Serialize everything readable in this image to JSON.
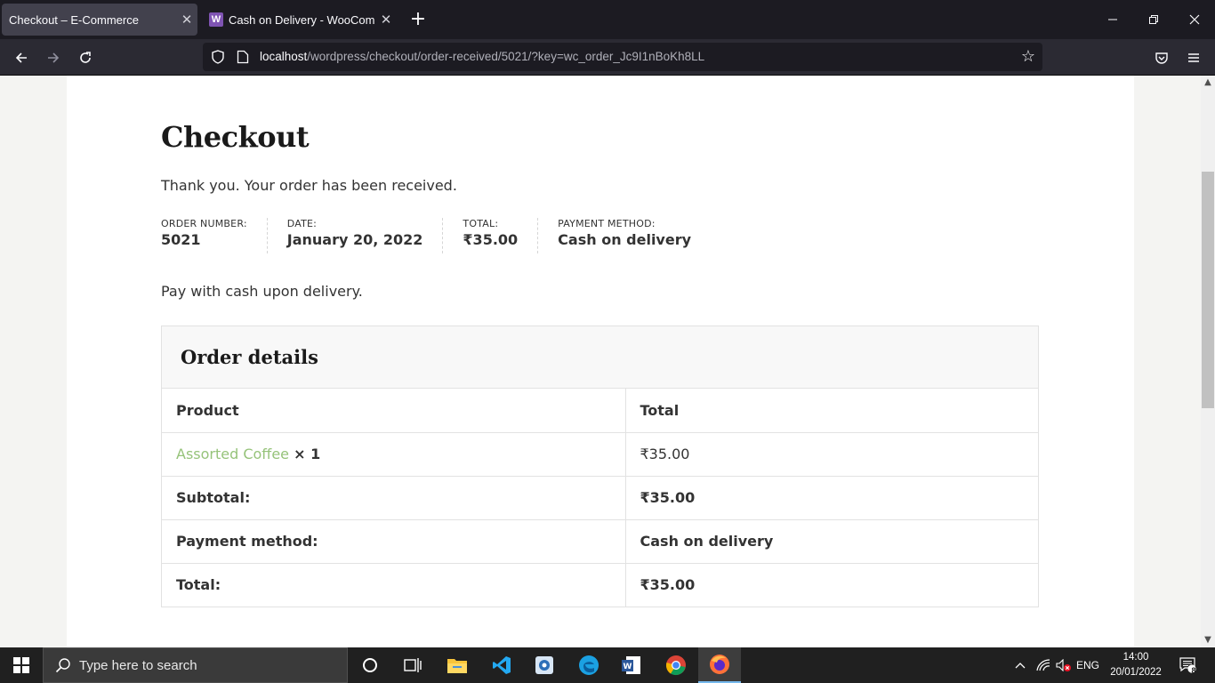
{
  "browser": {
    "tabs": [
      {
        "title": "Checkout – E-Commerce",
        "active": true
      },
      {
        "title": "Cash on Delivery - WooCommerce",
        "active": false,
        "favicon": "W"
      }
    ],
    "url": {
      "host": "localhost",
      "path": "/wordpress/checkout/order-received/5021/?key=wc_order_Jc9I1nBoKh8LL"
    }
  },
  "page": {
    "title": "Checkout",
    "thank_you": "Thank you. Your order has been received.",
    "overview": [
      {
        "label": "ORDER NUMBER:",
        "value": "5021"
      },
      {
        "label": "DATE:",
        "value": "January 20, 2022"
      },
      {
        "label": "TOTAL:",
        "value": "₹35.00"
      },
      {
        "label": "PAYMENT METHOD:",
        "value": "Cash on delivery"
      }
    ],
    "pay_note": "Pay with cash upon delivery.",
    "order_details": {
      "heading": "Order details",
      "col_product": "Product",
      "col_total": "Total",
      "item": {
        "name": "Assorted Coffee",
        "qty": "× 1",
        "total": "₹35.00"
      },
      "rows": [
        {
          "label": "Subtotal:",
          "value": "₹35.00"
        },
        {
          "label": "Payment method:",
          "value": "Cash on delivery"
        },
        {
          "label": "Total:",
          "value": "₹35.00"
        }
      ]
    }
  },
  "taskbar": {
    "search_placeholder": "Type here to search",
    "language": "ENG",
    "time": "14:00",
    "date": "20/01/2022",
    "notifications": "8"
  },
  "colors": {
    "accent": "#96c37a",
    "chrome_dark": "#1c1b22",
    "taskbar": "#202020"
  }
}
